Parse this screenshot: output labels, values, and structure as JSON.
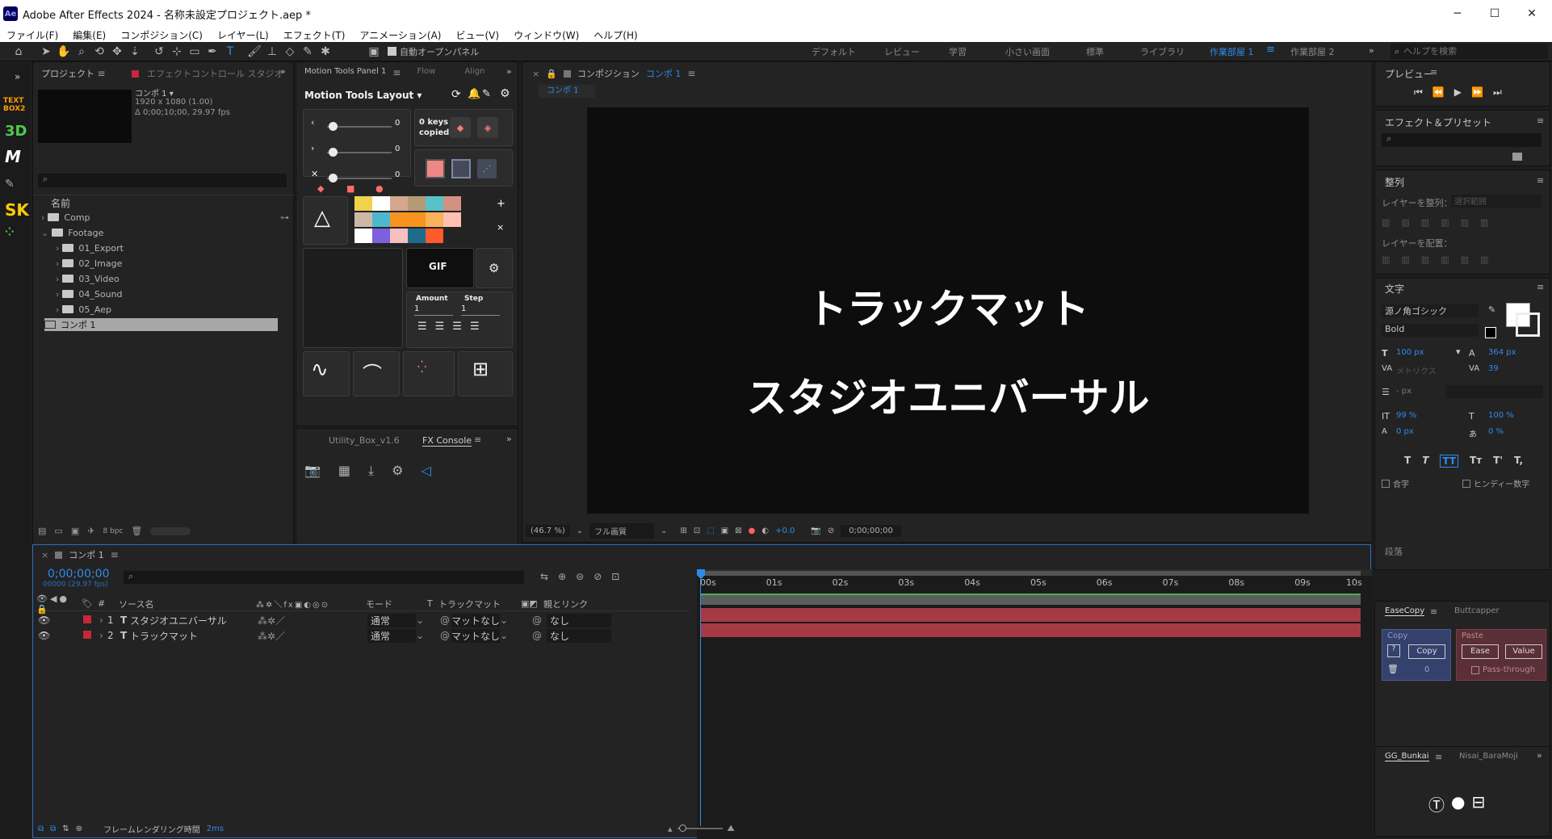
{
  "app": {
    "title": "Adobe After Effects 2024 - 名称未設定プロジェクト.aep *",
    "logo": "Ae"
  },
  "window_controls": {
    "minimize": "─",
    "maximize": "☐",
    "close": "✕"
  },
  "menu": [
    "ファイル(F)",
    "編集(E)",
    "コンポジション(C)",
    "レイヤー(L)",
    "エフェクト(T)",
    "アニメーション(A)",
    "ビュー(V)",
    "ウィンドウ(W)",
    "ヘルプ(H)"
  ],
  "toolbar": {
    "auto_open": "自動オープンパネル",
    "workspaces": [
      "デフォルト",
      "レビュー",
      "学習",
      "小さい画面",
      "標準",
      "ライブラリ",
      "作業部屋 1",
      "作業部屋 2"
    ],
    "active_workspace": "作業部屋 1",
    "help_placeholder": "ヘルプを検索"
  },
  "sidebar": {
    "icons": [
      "TEXT BOX2",
      "3D",
      "M",
      "SK"
    ]
  },
  "project": {
    "tab": "プロジェクト",
    "tab2": "エフェクトコントロール スタジオ",
    "comp_name": "コンポ 1 ▾",
    "comp_info1": "1920 x 1080 (1.00)",
    "comp_info2": "Δ 0;00;10;00, 29.97 fps",
    "col_name": "名前",
    "items": [
      {
        "name": "Comp",
        "level": 0,
        "open": false
      },
      {
        "name": "Footage",
        "level": 0,
        "open": true
      },
      {
        "name": "01_Export",
        "level": 1,
        "open": false
      },
      {
        "name": "02_Image",
        "level": 1,
        "open": false
      },
      {
        "name": "03_Video",
        "level": 1,
        "open": false
      },
      {
        "name": "04_Sound",
        "level": 1,
        "open": false
      },
      {
        "name": "05_Aep",
        "level": 1,
        "open": false
      },
      {
        "name": "コンポ 1",
        "level": 0,
        "comp": true
      }
    ],
    "bpc": "8 bpc"
  },
  "motion_tools": {
    "tab": "Motion Tools Panel 1",
    "tab2": "Flow",
    "tab3": "Align",
    "layout": "Motion Tools Layout",
    "values": [
      "0",
      "0",
      "0"
    ],
    "keys": "0 keys",
    "copied": "copied",
    "gif": "GIF",
    "amount": "Amount",
    "step": "Step",
    "amount_val": "1",
    "step_val": "1",
    "colors": [
      "#f1d34a",
      "#ffffff",
      "#d4a88e",
      "#b59a76",
      "#59c2c8",
      "#d29182",
      "#cdb8a8",
      "#4eb7cf",
      "#f7931e",
      "#f7931e",
      "#f9b15a",
      "#ffc0b2",
      "#ffffff",
      "#7d5fe0",
      "#f6c0c0",
      "#1e6b8b",
      "#ff5a2c"
    ]
  },
  "utility": {
    "tab": "Utility_Box_v1.6",
    "tab2": "FX Console"
  },
  "comp_viewer": {
    "tab": "コンポジション",
    "comp_name": "コンポ 1",
    "subtab": "コンポ 1",
    "text1": "トラックマット",
    "text2": "スタジオユニバーサル",
    "zoom": "(46.7 %)",
    "quality": "フル画質",
    "exposure": "+0.0",
    "timecode": "0;00;00;00"
  },
  "right": {
    "preview": "プレビュー",
    "effects": "エフェクト＆プリセット",
    "align": "整列",
    "align_layers": "レイヤーを整列：",
    "align_to": "選択範囲",
    "distribute": "レイヤーを配置：",
    "text": "文字",
    "font": "源ノ角ゴシック",
    "style": "Bold",
    "size": "100 px",
    "leading": "364 px",
    "kerning": "メトリクス",
    "tracking": "39",
    "stroke": "- px",
    "vscale": "99 %",
    "hscale": "100 %",
    "baseline": "0 px",
    "tsume": "0 %",
    "ligature": "合字",
    "hindi": "ヒンディー数字",
    "paragraph": "段落",
    "easecopy": "EaseCopy",
    "buttcapper": "Buttcapper",
    "copy_lbl": "Copy",
    "copy_btn": "Copy",
    "paste_lbl": "Paste",
    "ease_btn": "Ease",
    "value_btn": "Value",
    "pass": "Pass-through",
    "q": "?",
    "zero": "0",
    "gg": "GG_Bunkai",
    "nisai": "Nisai_BaraMoji"
  },
  "timeline": {
    "tab": "コンポ 1",
    "timecode": "0;00;00;00",
    "fps": "00000 (29.97 fps)",
    "cols": {
      "num": "#",
      "source": "ソース名",
      "mode": "モード",
      "t": "T",
      "matte": "トラックマット",
      "parent": "親とリンク"
    },
    "layers": [
      {
        "num": "1",
        "name": "スタジオユニバーサル",
        "mode": "通常",
        "matte": "マットなし",
        "parent": "なし"
      },
      {
        "num": "2",
        "name": "トラックマット",
        "mode": "通常",
        "matte": "マットなし",
        "parent": "なし"
      }
    ],
    "ticks": [
      "00s",
      "01s",
      "02s",
      "03s",
      "04s",
      "05s",
      "06s",
      "07s",
      "08s",
      "09s",
      "10s"
    ],
    "render_label": "フレームレンダリング時間",
    "render_val": "2ms"
  }
}
